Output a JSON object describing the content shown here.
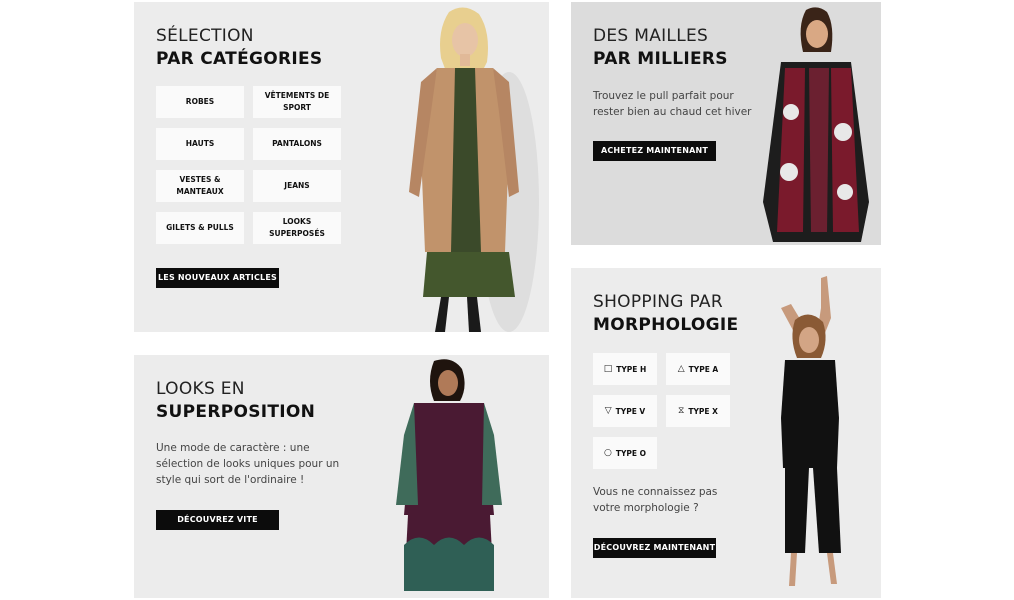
{
  "categories_panel": {
    "title_light": "SÉLECTION",
    "title_bold": "PAR CATÉGORIES",
    "categories": [
      {
        "label": "ROBES"
      },
      {
        "label": "VÊTEMENTS DE SPORT"
      },
      {
        "label": "HAUTS"
      },
      {
        "label": "PANTALONS"
      },
      {
        "label": "VESTES & MANTEAUX"
      },
      {
        "label": "JEANS"
      },
      {
        "label": "GILETS & PULLS"
      },
      {
        "label": "LOOKS SUPERPOSÉS"
      }
    ],
    "cta": "LES NOUVEAUX ARTICLES"
  },
  "knit_panel": {
    "title_light": "DES MAILLES",
    "title_bold": "PAR MILLIERS",
    "description": "Trouvez le pull parfait pour rester bien au chaud cet hiver",
    "cta": "ACHETEZ MAINTENANT"
  },
  "layering_panel": {
    "title_light": "LOOKS EN",
    "title_bold": "SUPERPOSITION",
    "description": "Une mode de caractère : une sélection de looks uniques pour un style qui sort de l'ordinaire !",
    "cta": "DÉCOUVREZ VITE"
  },
  "morphology_panel": {
    "title_light": "SHOPPING PAR",
    "title_bold": "MORPHOLOGIE",
    "types": [
      {
        "symbol": "□",
        "label": "TYPE H"
      },
      {
        "symbol": "△",
        "label": "TYPE A"
      },
      {
        "symbol": "▽",
        "label": "TYPE V"
      },
      {
        "symbol": "⧖",
        "label": "TYPE X"
      },
      {
        "symbol": "○",
        "label": "TYPE O"
      }
    ],
    "question": "Vous ne connaissez pas votre morphologie ?",
    "cta": "DÉCOUVREZ MAINTENANT"
  },
  "colors": {
    "panel_light": "#ececec",
    "panel_grey": "#dcdcdc",
    "button": "#0c0c0c",
    "coat": "#c1936b",
    "dress_green": "#3b4a2a",
    "cardigan_red": "#7a1a2c",
    "plum_dress": "#4a1a33",
    "jumpsuit": "#111111"
  }
}
